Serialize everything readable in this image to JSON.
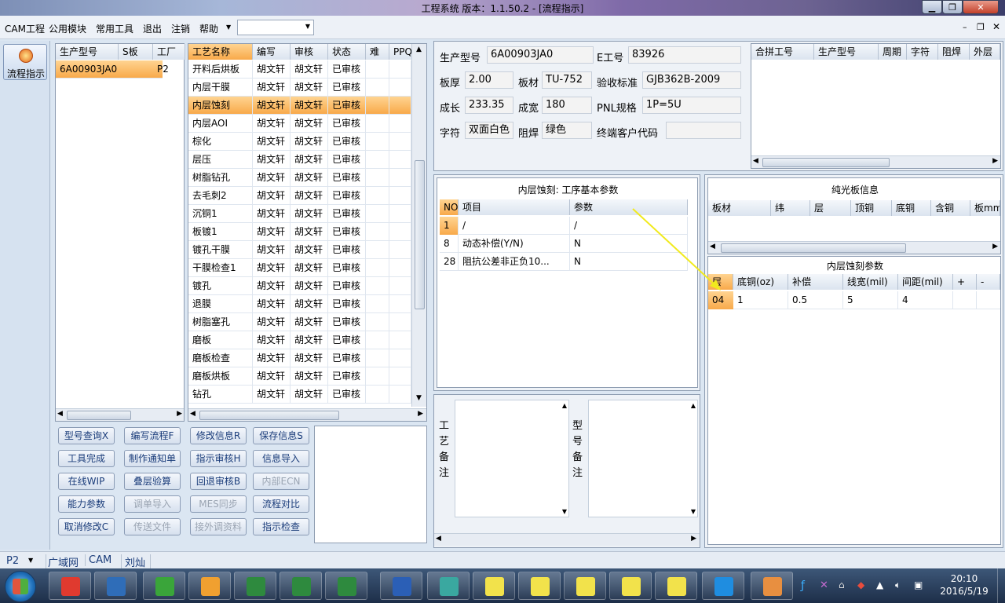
{
  "window": {
    "title": "工程系统  版本：1.1.50.2 - [流程指示]"
  },
  "menu": {
    "items": [
      "CAM工程",
      "公用模块",
      "常用工具",
      "退出",
      "注销",
      "帮助"
    ],
    "combo_value": ""
  },
  "nav": {
    "label": "流程指示"
  },
  "model_list": {
    "headers": [
      "生产型号",
      "S板",
      "工厂"
    ],
    "rows": [
      {
        "model": "6A00903JA0",
        "s": "",
        "factory": "P2"
      }
    ]
  },
  "process_list": {
    "headers": [
      "工艺名称",
      "编写",
      "审核",
      "状态",
      "难",
      "PPQE"
    ],
    "rows": [
      [
        "开料后烘板",
        "胡文轩",
        "胡文轩",
        "已审核"
      ],
      [
        "内层干膜",
        "胡文轩",
        "胡文轩",
        "已审核"
      ],
      [
        "内层蚀刻",
        "胡文轩",
        "胡文轩",
        "已审核"
      ],
      [
        "内层AOI",
        "胡文轩",
        "胡文轩",
        "已审核"
      ],
      [
        "棕化",
        "胡文轩",
        "胡文轩",
        "已审核"
      ],
      [
        "层压",
        "胡文轩",
        "胡文轩",
        "已审核"
      ],
      [
        "树脂钻孔",
        "胡文轩",
        "胡文轩",
        "已审核"
      ],
      [
        "去毛刺2",
        "胡文轩",
        "胡文轩",
        "已审核"
      ],
      [
        "沉铜1",
        "胡文轩",
        "胡文轩",
        "已审核"
      ],
      [
        "板镀1",
        "胡文轩",
        "胡文轩",
        "已审核"
      ],
      [
        "镀孔干膜",
        "胡文轩",
        "胡文轩",
        "已审核"
      ],
      [
        "干膜检查1",
        "胡文轩",
        "胡文轩",
        "已审核"
      ],
      [
        "镀孔",
        "胡文轩",
        "胡文轩",
        "已审核"
      ],
      [
        "退膜",
        "胡文轩",
        "胡文轩",
        "已审核"
      ],
      [
        "树脂塞孔",
        "胡文轩",
        "胡文轩",
        "已审核"
      ],
      [
        "磨板",
        "胡文轩",
        "胡文轩",
        "已审核"
      ],
      [
        "磨板检查",
        "胡文轩",
        "胡文轩",
        "已审核"
      ],
      [
        "磨板烘板",
        "胡文轩",
        "胡文轩",
        "已审核"
      ],
      [
        "钻孔",
        "胡文轩",
        "胡文轩",
        "已审核"
      ]
    ]
  },
  "buttons": [
    [
      "型号查询X",
      "编写流程F",
      "修改信息R",
      "保存信息S"
    ],
    [
      "工具完成",
      "制作通知单",
      "指示审核H",
      "信息导入"
    ],
    [
      "在线WIP",
      "叠层验算",
      "回退审核B",
      "内部ECN"
    ],
    [
      "能力参数",
      "调单导入",
      "MES同步",
      "流程对比"
    ],
    [
      "取消修改C",
      "传送文件",
      "接外调资料",
      "指示检查"
    ]
  ],
  "disabled_buttons": [
    "内部ECN",
    "调单导入",
    "MES同步",
    "传送文件",
    "接外调资料"
  ],
  "info": {
    "model_label": "生产型号",
    "model": "6A00903JA0",
    "eno_label": "E工号",
    "eno": "83926",
    "thick_label": "板厚",
    "thick": "2.00",
    "material_label": "板材",
    "material": "TU-752",
    "std_label": "验收标准",
    "std": "GJB362B-2009",
    "len_label": "成长",
    "len": "233.35",
    "wid_label": "成宽",
    "wid": "180",
    "pnl_label": "PNL规格",
    "pnl": "1P=5U",
    "char_label": "字符",
    "char": "双面白色",
    "mask_label": "阻焊",
    "mask": "绿色",
    "cust_label": "终端客户代码",
    "cust": ""
  },
  "combined": {
    "headers": [
      "合拼工号",
      "生产型号",
      "周期",
      "字符",
      "阻焊",
      "外层"
    ]
  },
  "step_params": {
    "title": "内层蚀刻: 工序基本参数",
    "headers": [
      "NO",
      "项目",
      "参数"
    ],
    "rows": [
      [
        "1",
        "/",
        "/"
      ],
      [
        "8",
        "动态补偿(Y/N)",
        "N"
      ],
      [
        "28",
        "阻抗公差非正负10...",
        "N"
      ]
    ]
  },
  "bare_board": {
    "title": "纯光板信息",
    "headers": [
      "板材",
      "纬",
      "层",
      "顶铜",
      "底铜",
      "含铜",
      "板mm"
    ]
  },
  "etch_params": {
    "title": "内层蚀刻参数",
    "headers": [
      "层",
      "底铜(oz)",
      "补偿",
      "线宽(mil)",
      "间距(mil)",
      "+",
      "-"
    ],
    "rows": [
      [
        "04",
        "1",
        "0.5",
        "5",
        "4",
        "",
        ""
      ]
    ]
  },
  "notes": {
    "process_label": "工艺备注",
    "model_label": "型号备注"
  },
  "status": {
    "factory": "P2",
    "net": "广域网",
    "app": "CAM",
    "user": "刘灿"
  },
  "taskbar": {
    "time": "20:10",
    "date": "2016/5/19"
  },
  "colors": {
    "selection": "#f8a94a",
    "accent": "#1a3c7a"
  }
}
